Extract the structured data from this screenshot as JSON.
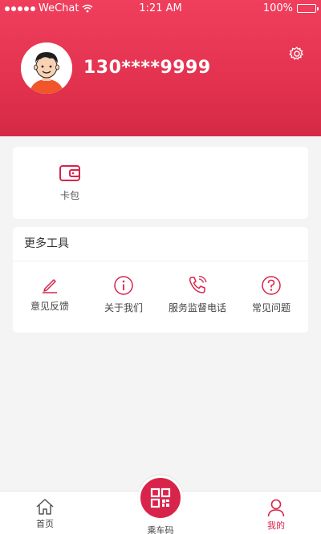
{
  "status_bar": {
    "carrier": "WeChat",
    "time": "1:21 AM",
    "battery": "100%"
  },
  "profile": {
    "phone": "130****9999"
  },
  "wallet": {
    "label": "卡包"
  },
  "tools": {
    "title": "更多工具",
    "items": [
      {
        "label": "意见反馈",
        "icon": "pencil-icon"
      },
      {
        "label": "关于我们",
        "icon": "info-icon"
      },
      {
        "label": "服务监督电话",
        "icon": "phone-icon"
      },
      {
        "label": "常见问题",
        "icon": "question-icon"
      }
    ]
  },
  "tabbar": {
    "home": "首页",
    "ride": "乘车码",
    "mine": "我的"
  },
  "colors": {
    "brand": "#d8244a",
    "header_top": "#ef3f5d",
    "background": "#f4f4f4"
  }
}
